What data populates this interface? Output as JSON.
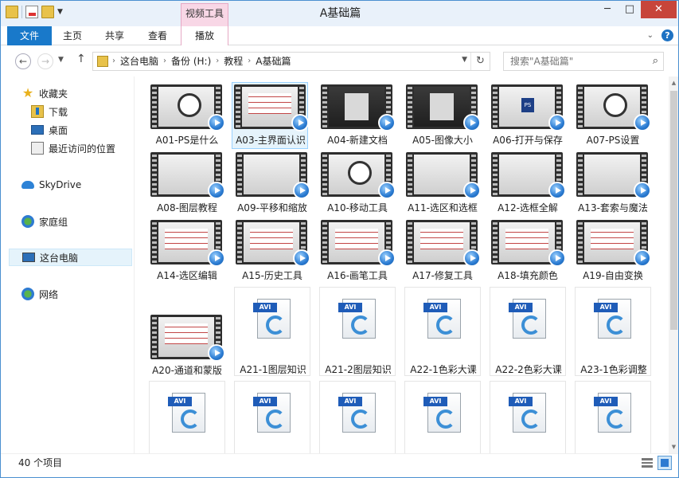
{
  "window": {
    "title": "A基础篇",
    "context_tab_group": "视频工具",
    "controls": {
      "minimize": "─",
      "maximize": "□",
      "close": "✕"
    }
  },
  "ribbon": {
    "file_tab": "文件",
    "tabs": [
      "主页",
      "共享",
      "查看",
      "播放"
    ]
  },
  "address": {
    "crumbs": [
      "这台电脑",
      "备份 (H:)",
      "教程",
      "A基础篇"
    ],
    "search_placeholder": "搜索\"A基础篇\""
  },
  "sidebar": {
    "favorites": "收藏夹",
    "downloads": "下载",
    "desktop": "桌面",
    "recent": "最近访问的位置",
    "skydrive": "SkyDrive",
    "homegroup": "家庭组",
    "this_pc": "这台电脑",
    "network": "网络"
  },
  "files": {
    "row1": [
      "A01-PS是什么",
      "A03-主界面认识",
      "A04-新建文档",
      "A05-图像大小",
      "A06-打开与保存",
      "A07-PS设置"
    ],
    "row2": [
      "A08-图层教程",
      "A09-平移和缩放",
      "A10-移动工具",
      "A11-选区和选框",
      "A12-选框全解",
      "A13-套索与魔法"
    ],
    "row3": [
      "A14-选区编辑",
      "A15-历史工具",
      "A16-画笔工具",
      "A17-修复工具",
      "A18-填充颜色",
      "A19-自由变换"
    ],
    "row4_video": "A20-通道和蒙版",
    "row4_avi": [
      "A21-1图层知识",
      "A21-2图层知识",
      "A22-1色彩大课",
      "A22-2色彩大课",
      "A23-1色彩调整"
    ],
    "avi_badge": "AVI"
  },
  "status": {
    "item_count": "40 个项目"
  }
}
